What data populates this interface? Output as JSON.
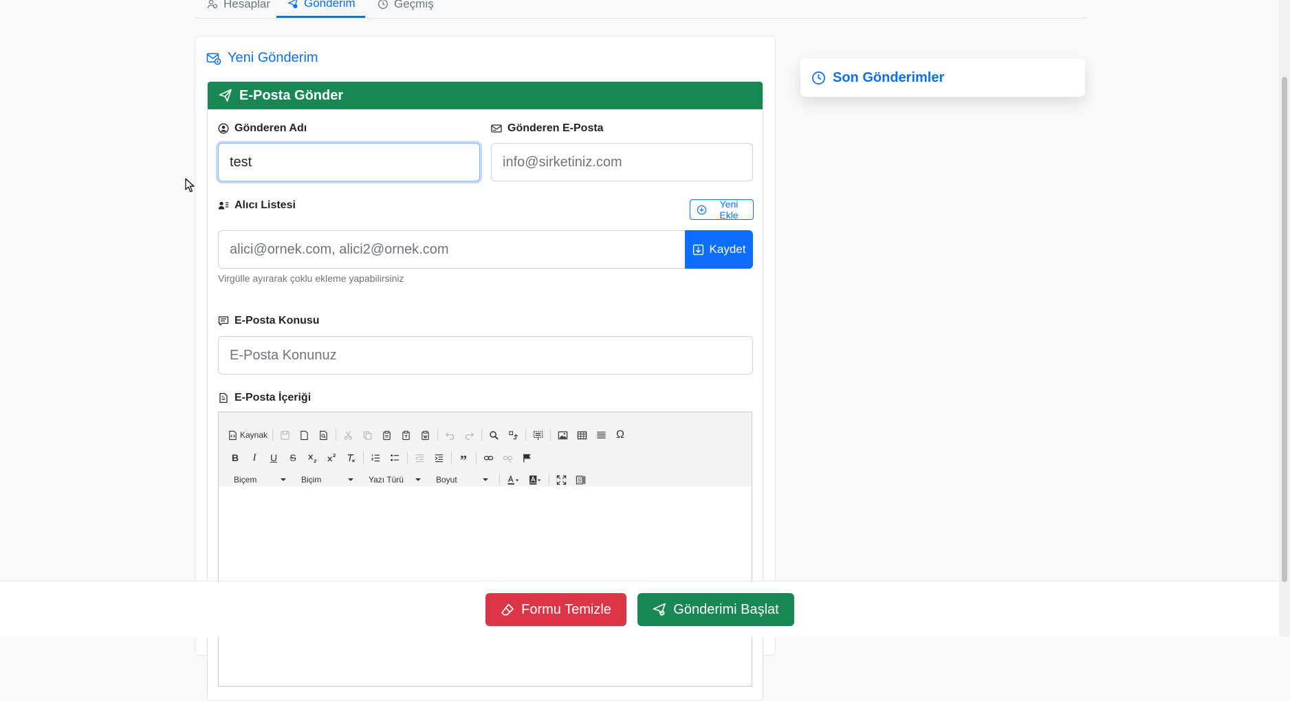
{
  "tabs": [
    {
      "label": "Hesaplar",
      "icon": "users-icon"
    },
    {
      "label": "Gönderim",
      "icon": "send-icon"
    },
    {
      "label": "Geçmiş",
      "icon": "clock-icon"
    }
  ],
  "main": {
    "title": "Yeni Gönderim",
    "card_header": "E-Posta Gönder",
    "sender_name": {
      "label": "Gönderen Adı",
      "value": "test"
    },
    "sender_email": {
      "label": "Gönderen E-Posta",
      "placeholder": "info@sirketiniz.com"
    },
    "recipients": {
      "label": "Alıcı Listesi",
      "add_new": "Yeni Ekle",
      "placeholder": "alici@ornek.com, alici2@ornek.com",
      "save": "Kaydet",
      "help": "Virgülle ayırarak çoklu ekleme yapabilirsiniz"
    },
    "subject": {
      "label": "E-Posta Konusu",
      "placeholder": "E-Posta Konunuz"
    },
    "content": {
      "label": "E-Posta İçeriği"
    }
  },
  "editor": {
    "source_label": "Kaynak",
    "combos": [
      "Biçem",
      "Biçim",
      "Yazı Türü",
      "Boyut"
    ]
  },
  "side": {
    "title": "Son Gönderimler"
  },
  "footer": {
    "clear": "Formu Temizle",
    "start": "Gönderimi Başlat"
  },
  "colors": {
    "primary": "#0d6efd",
    "success": "#198754",
    "danger": "#dc3545"
  }
}
